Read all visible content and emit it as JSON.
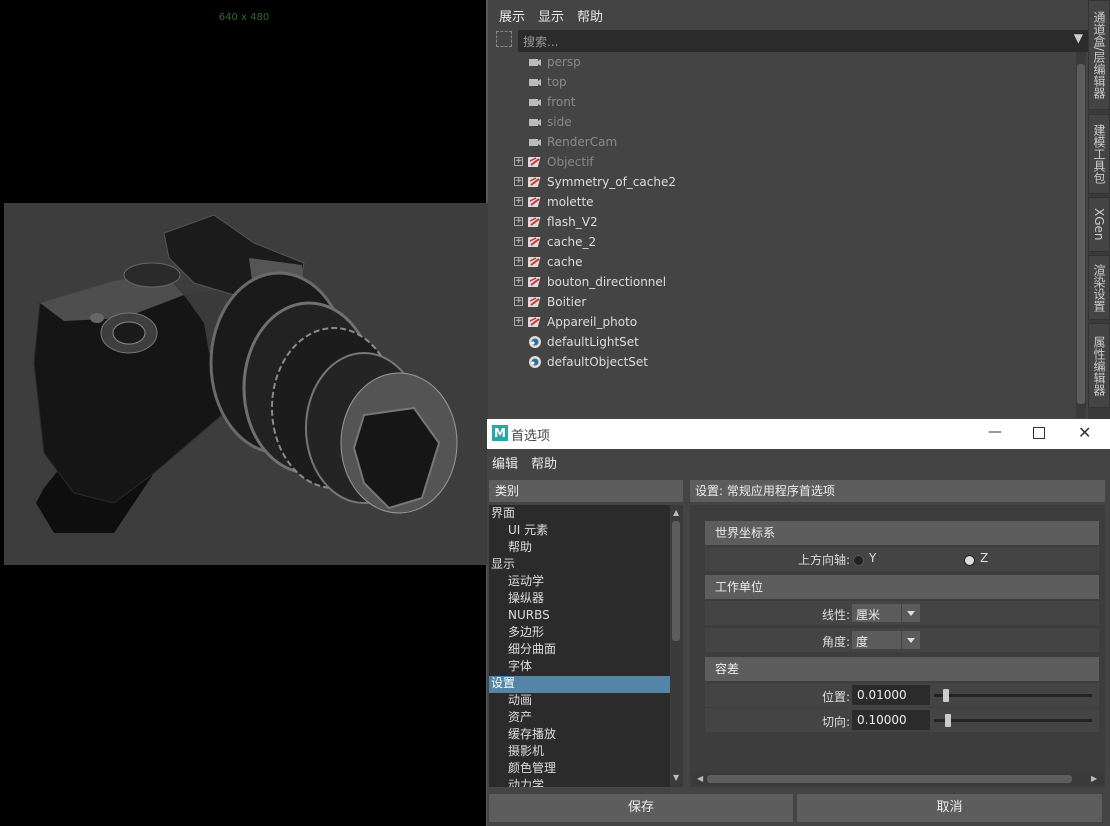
{
  "viewport": {
    "resolution_label": "640 x 480"
  },
  "outliner": {
    "menu": [
      "展示",
      "显示",
      "帮助"
    ],
    "search_placeholder": "搜索...",
    "items": [
      {
        "label": "persp",
        "icon": "camera-icon",
        "expandable": false,
        "dim": true
      },
      {
        "label": "top",
        "icon": "camera-icon",
        "expandable": false,
        "dim": true
      },
      {
        "label": "front",
        "icon": "camera-icon",
        "expandable": false,
        "dim": true
      },
      {
        "label": "side",
        "icon": "camera-icon",
        "expandable": false,
        "dim": true
      },
      {
        "label": "RenderCam",
        "icon": "camera-icon",
        "expandable": false,
        "dim": true
      },
      {
        "label": "Objectif",
        "icon": "transform-icon",
        "expandable": true,
        "dim": true
      },
      {
        "label": "Symmetry_of_cache2",
        "icon": "transform-icon",
        "expandable": true,
        "dim": false
      },
      {
        "label": "molette",
        "icon": "transform-icon",
        "expandable": true,
        "dim": false
      },
      {
        "label": "flash_V2",
        "icon": "transform-icon",
        "expandable": true,
        "dim": false
      },
      {
        "label": "cache_2",
        "icon": "transform-icon",
        "expandable": true,
        "dim": false
      },
      {
        "label": "cache",
        "icon": "transform-icon",
        "expandable": true,
        "dim": false
      },
      {
        "label": "bouton_directionnel",
        "icon": "transform-icon",
        "expandable": true,
        "dim": false
      },
      {
        "label": "Boitier",
        "icon": "transform-icon",
        "expandable": true,
        "dim": false
      },
      {
        "label": "Appareil_photo",
        "icon": "transform-icon",
        "expandable": true,
        "dim": false
      },
      {
        "label": "defaultLightSet",
        "icon": "set-icon",
        "expandable": false,
        "dim": false
      },
      {
        "label": "defaultObjectSet",
        "icon": "set-icon",
        "expandable": false,
        "dim": false
      }
    ]
  },
  "side_tabs": [
    "通道盒/层编辑器",
    "建模工具包",
    "XGen",
    "渲染设置",
    "属性编辑器"
  ],
  "prefs": {
    "title": "首选项",
    "menu": [
      "编辑",
      "帮助"
    ],
    "category_header": "类别",
    "settings_header": "设置: 常规应用程序首选项",
    "categories": [
      {
        "label": "界面",
        "sub": false
      },
      {
        "label": "UI 元素",
        "sub": true
      },
      {
        "label": "帮助",
        "sub": true
      },
      {
        "label": "显示",
        "sub": false
      },
      {
        "label": "运动学",
        "sub": true
      },
      {
        "label": "操纵器",
        "sub": true
      },
      {
        "label": "NURBS",
        "sub": true
      },
      {
        "label": "多边形",
        "sub": true
      },
      {
        "label": "细分曲面",
        "sub": true
      },
      {
        "label": "字体",
        "sub": true
      },
      {
        "label": "设置",
        "sub": false
      },
      {
        "label": "动画",
        "sub": true
      },
      {
        "label": "资产",
        "sub": true
      },
      {
        "label": "缓存播放",
        "sub": true
      },
      {
        "label": "摄影机",
        "sub": true
      },
      {
        "label": "颜色管理",
        "sub": true
      },
      {
        "label": "动力学",
        "sub": true
      }
    ],
    "selected_category": "设置",
    "world_coords": {
      "title": "世界坐标系",
      "up_axis_label": "上方向轴:",
      "options": [
        "Y",
        "Z"
      ],
      "selected": "Z"
    },
    "working_units": {
      "title": "工作单位",
      "linear_label": "线性:",
      "linear_value": "厘米",
      "angular_label": "角度:",
      "angular_value": "度"
    },
    "tolerance": {
      "title": "容差",
      "position_label": "位置:",
      "position_value": "0.01000",
      "position_slider": 0.1,
      "tangent_label": "切向:",
      "tangent_value": "0.10000",
      "tangent_slider": 0.1
    },
    "save_label": "保存",
    "cancel_label": "取消"
  },
  "colors": {
    "selection": "#5285a6",
    "title_bar": "#ffffff",
    "maya_logo": "#2aa5a8"
  }
}
